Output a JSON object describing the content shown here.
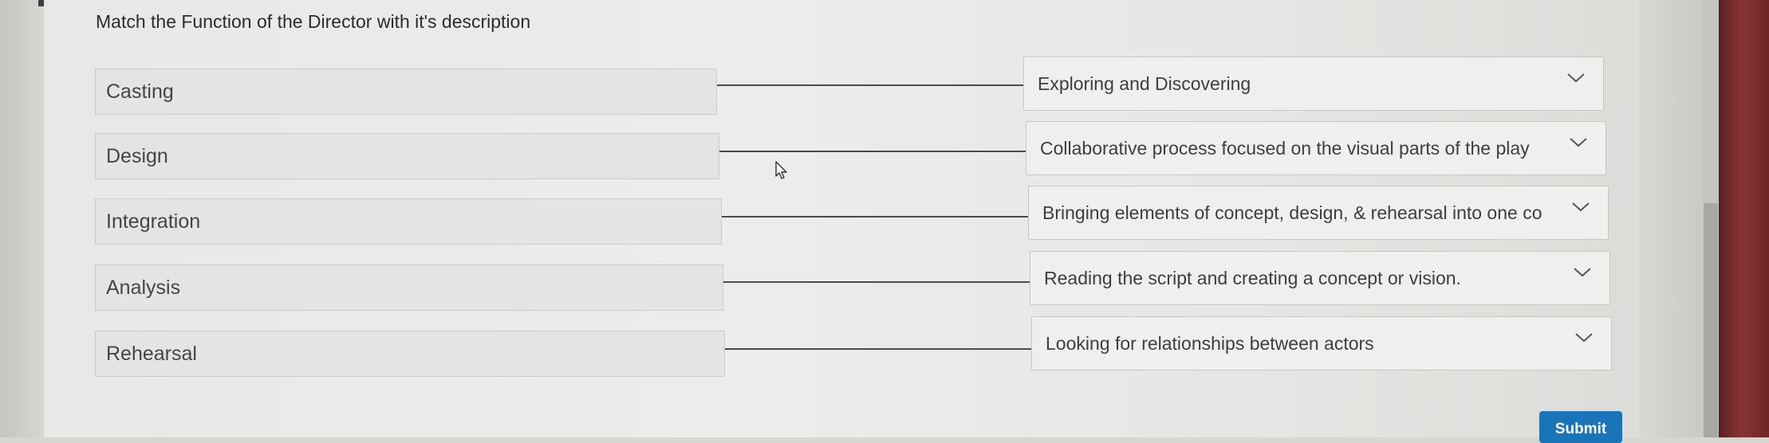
{
  "question": "Match the Function of the Director with it's description",
  "pairs": [
    {
      "term": "Casting",
      "answer": "Exploring and Discovering"
    },
    {
      "term": "Design",
      "answer": "Collaborative process focused on the visual parts of the play"
    },
    {
      "term": "Integration",
      "answer": "Bringing elements of concept, design, & rehearsal into one co"
    },
    {
      "term": "Analysis",
      "answer": "Reading the script and creating a concept or vision."
    },
    {
      "term": "Rehearsal",
      "answer": "Looking for relationships between actors"
    }
  ],
  "submit_label": "Submit",
  "colors": {
    "submit": "#1a74b8",
    "panel": "#ececea",
    "text": "#3e3e3e"
  },
  "icons": {
    "dropdown": "chevron-down-icon",
    "cursor": "mouse-pointer-icon"
  }
}
